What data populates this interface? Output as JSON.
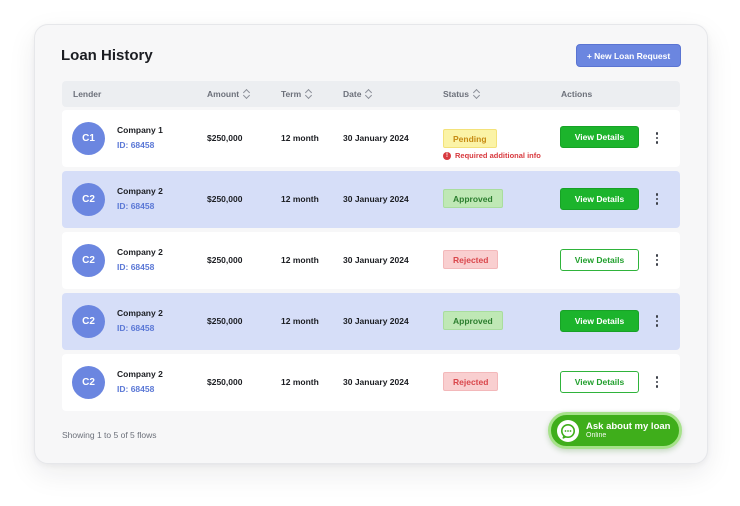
{
  "header": {
    "title": "Loan History",
    "new_button_label": "+ New Loan Request"
  },
  "table": {
    "columns": [
      "Lender",
      "Amount",
      "Term",
      "Date",
      "Status",
      "Actions"
    ],
    "rows": [
      {
        "avatar": "C1",
        "company": "Company 1",
        "id": "ID: 68458",
        "amount": "$250,000",
        "term": "12 month",
        "date": "30 January 2024",
        "status": "Pending",
        "note": "Required additional info",
        "action": "View Details"
      },
      {
        "avatar": "C2",
        "company": "Company 2",
        "id": "ID: 68458",
        "amount": "$250,000",
        "term": "12 month",
        "date": "30 January 2024",
        "status": "Approved",
        "action": "View Details"
      },
      {
        "avatar": "C2",
        "company": "Company 2",
        "id": "ID: 68458",
        "amount": "$250,000",
        "term": "12 month",
        "date": "30 January 2024",
        "status": "Rejected",
        "action": "View Details"
      },
      {
        "avatar": "C2",
        "company": "Company 2",
        "id": "ID: 68458",
        "amount": "$250,000",
        "term": "12 month",
        "date": "30 January 2024",
        "status": "Approved",
        "action": "View Details"
      },
      {
        "avatar": "C2",
        "company": "Company 2",
        "id": "ID: 68458",
        "amount": "$250,000",
        "term": "12 month",
        "date": "30 January 2024",
        "status": "Rejected",
        "action": "View Details"
      }
    ]
  },
  "footer": {
    "showing": "Showing 1 to 5 of 5 flows"
  },
  "chat": {
    "title": "Ask about my loan",
    "status": "Online",
    "icon": "chat-bubble-icon"
  },
  "colors": {
    "primary": "#6b86e0",
    "highlight_row": "#d6def8",
    "action_green": "#1cb42c",
    "pending_bg": "#fbf3a6",
    "approved_bg": "#bfe8b5",
    "rejected_bg": "#f9cfd0",
    "chat_green": "#3fae1b"
  }
}
